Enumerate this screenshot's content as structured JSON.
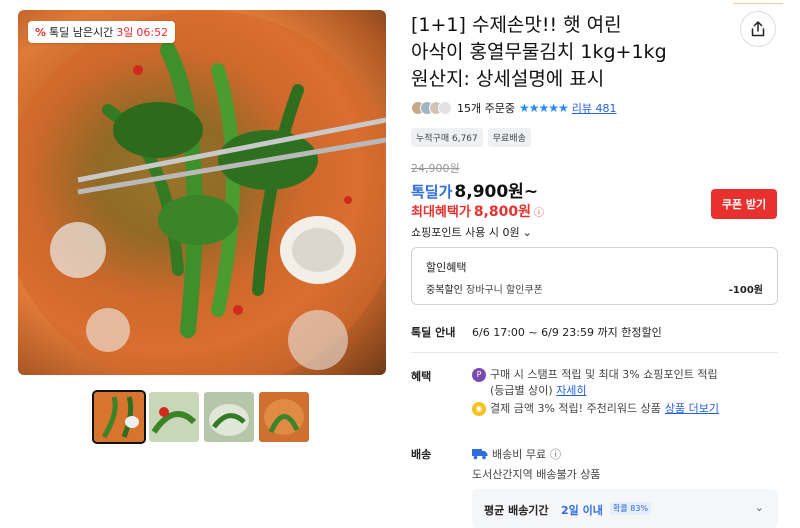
{
  "badge": {
    "label": "톡딜 남은시간",
    "days": "3일",
    "time": "06:52"
  },
  "product": {
    "title_line1": "[1+1] 수제손맛!! 햇 여린",
    "title_line2": "아삭이 홍열무물김치 1kg+1kg",
    "title_line3": "원산지: 상세설명에 표시"
  },
  "rating": {
    "orders": "15개 주문중",
    "stars": "★★★★★",
    "reviews": "리뷰 481"
  },
  "chips": [
    "누적구매 6,767",
    "무료배송"
  ],
  "price": {
    "original": "24,900원",
    "deal_label": "톡딜가",
    "deal_price": "8,900원~",
    "max_label": "최대혜택가",
    "max_price": "8,800원"
  },
  "coupon_button": "쿠폰 받기",
  "points": "쇼핑포인트 사용 시 0원",
  "discount": {
    "title": "할인혜택",
    "line_label": "중복할인",
    "line_desc": "장바구니 할인쿠폰",
    "amount": "-100원"
  },
  "deal_info": {
    "label": "톡딜 안내",
    "text": "6/6 17:00 ~ 6/9 23:59 까지 한정할인"
  },
  "benefits": {
    "label": "혜택",
    "line1": "구매 시 스탬프 적립 및 최대 3% 쇼핑포인트 적립",
    "line1b": "(등급별 상이)",
    "line1_link": "자세히",
    "line2": "결제 금액 3% 적립! 주천리워드 상품",
    "line2_link": "상품 더보기"
  },
  "shipping": {
    "label": "배송",
    "fee": "배송비 무료",
    "note": "도서산간지역 배송불가 상품",
    "avg_label": "평균 배송기간",
    "avg_value": "2일 이내",
    "probability": "확률 83%"
  },
  "icons": {
    "share": "share-icon",
    "info": "info-icon",
    "chevron": "chevron-down-icon",
    "truck": "truck-icon",
    "percent": "percent-icon"
  },
  "colors": {
    "accent_red": "#e8312f",
    "accent_blue": "#2f6de0",
    "star_blue": "#2b8cf6"
  }
}
